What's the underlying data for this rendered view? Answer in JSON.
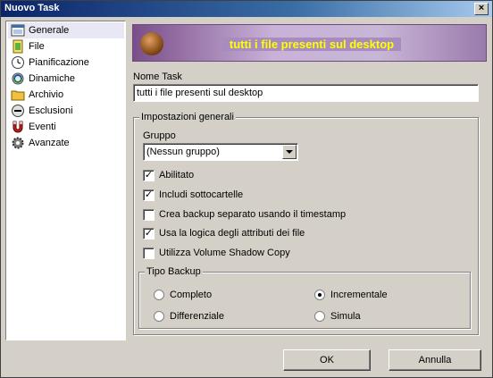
{
  "window": {
    "title": "Nuovo Task",
    "close_glyph": "×"
  },
  "sidebar": {
    "items": [
      {
        "label": "Generale",
        "icon": "window-icon",
        "selected": true
      },
      {
        "label": "File",
        "icon": "file-icon"
      },
      {
        "label": "Pianificazione",
        "icon": "clock-icon"
      },
      {
        "label": "Dinamiche",
        "icon": "cycle-icon"
      },
      {
        "label": "Archivio",
        "icon": "folder-icon"
      },
      {
        "label": "Esclusioni",
        "icon": "minus-icon"
      },
      {
        "label": "Eventi",
        "icon": "magnet-icon"
      },
      {
        "label": "Avanzate",
        "icon": "gear-icon"
      }
    ]
  },
  "banner": {
    "title": "tutti i file presenti sul desktop"
  },
  "task_name": {
    "label": "Nome Task",
    "value": "tutti i file presenti sul desktop"
  },
  "general": {
    "title": "Impostazioni generali",
    "group_label": "Gruppo",
    "group_value": "(Nessun gruppo)",
    "options": [
      {
        "label": "Abilitato",
        "checked": true
      },
      {
        "label": "Includi sottocartelle",
        "checked": true
      },
      {
        "label": "Crea backup separato usando il timestamp",
        "checked": false
      },
      {
        "label": "Usa la logica degli attributi dei file",
        "checked": true
      },
      {
        "label": "Utilizza Volume Shadow Copy",
        "checked": false
      }
    ]
  },
  "backup_type": {
    "title": "Tipo Backup",
    "options": [
      {
        "label": "Completo",
        "selected": false
      },
      {
        "label": "Incrementale",
        "selected": true
      },
      {
        "label": "Differenziale",
        "selected": false
      },
      {
        "label": "Simula",
        "selected": false
      }
    ]
  },
  "buttons": {
    "ok": "OK",
    "cancel": "Annulla"
  }
}
